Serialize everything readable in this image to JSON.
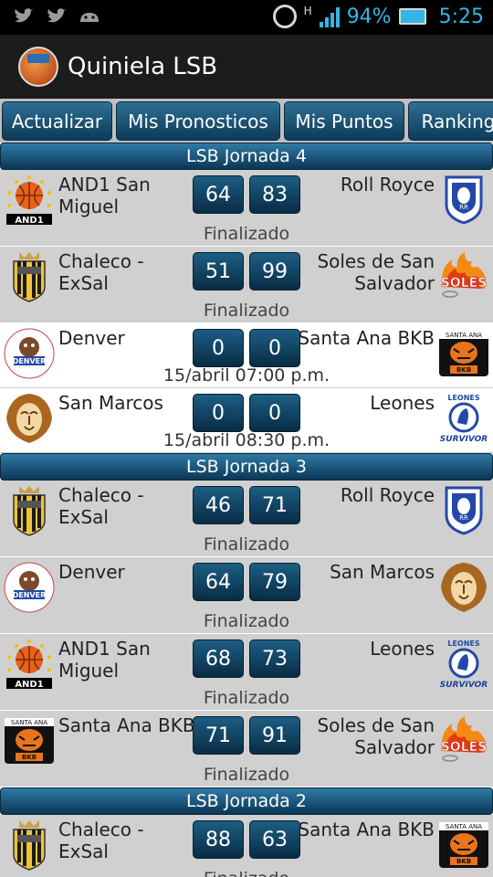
{
  "statusbar": {
    "battery": "94%",
    "time": "5:25",
    "network": "H",
    "icons_left": [
      "twitter-icon",
      "twitter-icon",
      "android-icon"
    ],
    "accent": "#33b5e5"
  },
  "app": {
    "title": "Quiniela LSB"
  },
  "tabs": [
    "Actualizar",
    "Mis Pronosticos",
    "Mis Puntos",
    "Ranking"
  ],
  "jornadas": [
    {
      "title": "LSB Jornada 4",
      "matches": [
        {
          "home": "AND1 San Miguel",
          "away": "Roll Royce",
          "score_home": "64",
          "score_away": "83",
          "status": "Finalizado",
          "home_logo": "and1",
          "away_logo": "rollroyce",
          "played": true
        },
        {
          "home": "Chaleco - ExSal",
          "away": "Soles de San Salvador",
          "score_home": "51",
          "score_away": "99",
          "status": "Finalizado",
          "home_logo": "chaleco",
          "away_logo": "soles",
          "played": true
        },
        {
          "home": "Denver",
          "away": "Santa Ana BKB",
          "score_home": "0",
          "score_away": "0",
          "status": "15/abril 07:00 p.m.",
          "home_logo": "denver",
          "away_logo": "santaana",
          "played": false
        },
        {
          "home": "San Marcos",
          "away": "Leones",
          "score_home": "0",
          "score_away": "0",
          "status": "15/abril 08:30 p.m.",
          "home_logo": "sanmarcos",
          "away_logo": "leones",
          "played": false
        }
      ]
    },
    {
      "title": "LSB Jornada 3",
      "matches": [
        {
          "home": "Chaleco - ExSal",
          "away": "Roll Royce",
          "score_home": "46",
          "score_away": "71",
          "status": "Finalizado",
          "home_logo": "chaleco",
          "away_logo": "rollroyce",
          "played": true
        },
        {
          "home": "Denver",
          "away": "San Marcos",
          "score_home": "64",
          "score_away": "79",
          "status": "Finalizado",
          "home_logo": "denver",
          "away_logo": "sanmarcos",
          "played": true
        },
        {
          "home": "AND1 San Miguel",
          "away": "Leones",
          "score_home": "68",
          "score_away": "73",
          "status": "Finalizado",
          "home_logo": "and1",
          "away_logo": "leones",
          "played": true
        },
        {
          "home": "Santa Ana BKB",
          "away": "Soles de San Salvador",
          "score_home": "71",
          "score_away": "91",
          "status": "Finalizado",
          "home_logo": "santaana",
          "away_logo": "soles",
          "played": true
        }
      ]
    },
    {
      "title": "LSB Jornada 2",
      "matches": [
        {
          "home": "Chaleco - ExSal",
          "away": "Santa Ana BKB",
          "score_home": "88",
          "score_away": "63",
          "status": "Finalizado",
          "home_logo": "chaleco",
          "away_logo": "santaana",
          "played": true
        }
      ]
    }
  ]
}
